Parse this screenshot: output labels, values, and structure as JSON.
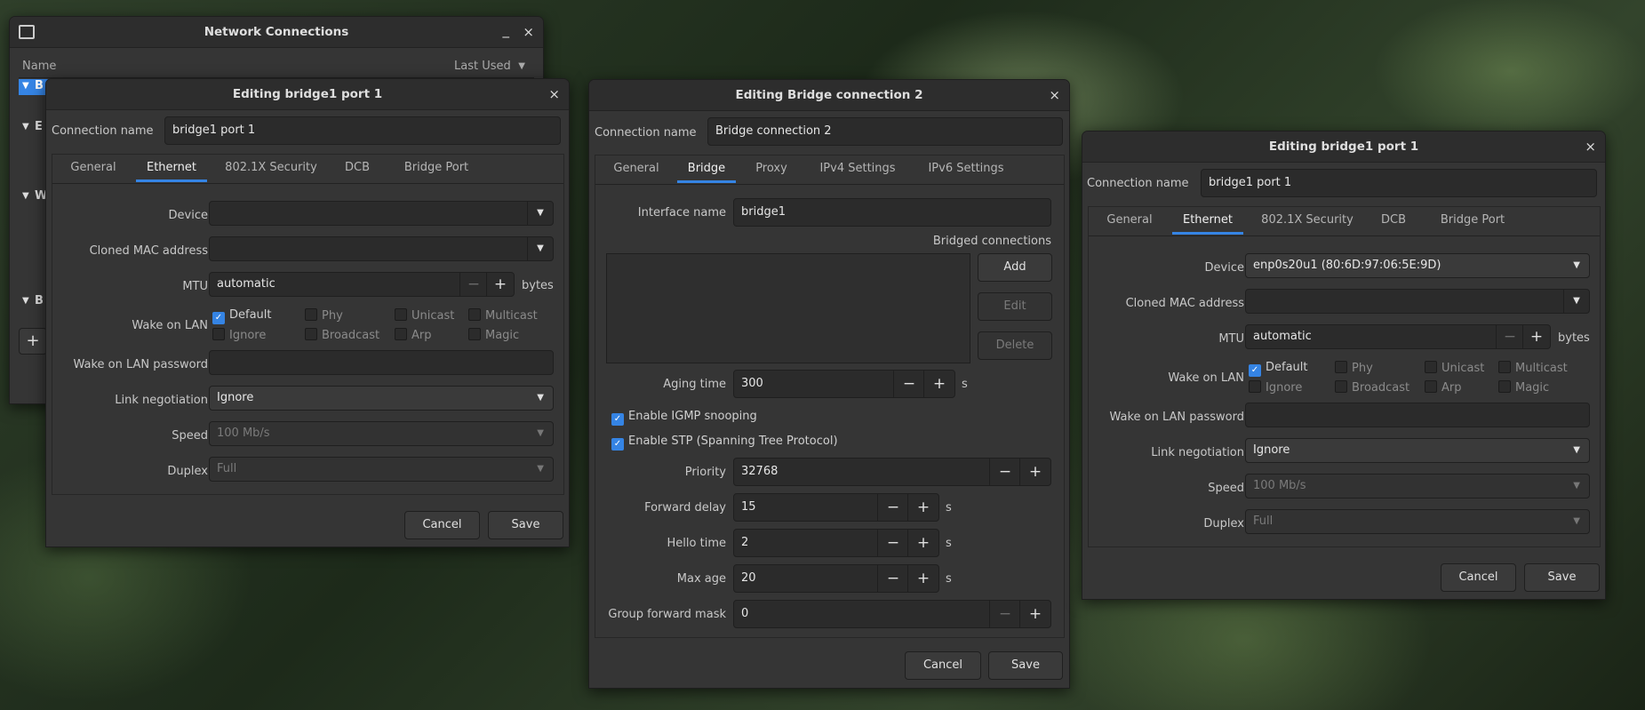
{
  "nc": {
    "title": "Network Connections",
    "col_name": "Name",
    "col_last_used": "Last Used",
    "items": [
      "B",
      "E",
      "W",
      "B"
    ],
    "add": "+"
  },
  "w1": {
    "title": "Editing bridge1 port 1",
    "conn_name_label": "Connection name",
    "conn_name_value": "bridge1 port 1",
    "tabs": [
      "General",
      "Ethernet",
      "802.1X Security",
      "DCB",
      "Bridge Port"
    ],
    "device_label": "Device",
    "device_value": "",
    "cloned_mac_label": "Cloned MAC address",
    "mtu_label": "MTU",
    "mtu_value": "automatic",
    "mtu_unit": "bytes",
    "wol_label": "Wake on LAN",
    "wol_opts": [
      "Default",
      "Phy",
      "Unicast",
      "Multicast",
      "Ignore",
      "Broadcast",
      "Arp",
      "Magic"
    ],
    "wol_pw_label": "Wake on LAN password",
    "link_neg_label": "Link negotiation",
    "link_neg_value": "Ignore",
    "speed_label": "Speed",
    "speed_value": "100 Mb/s",
    "duplex_label": "Duplex",
    "duplex_value": "Full",
    "cancel": "Cancel",
    "save": "Save"
  },
  "w2": {
    "title": "Editing Bridge connection 2",
    "conn_name_label": "Connection name",
    "conn_name_value": "Bridge connection 2",
    "tabs": [
      "General",
      "Bridge",
      "Proxy",
      "IPv4 Settings",
      "IPv6 Settings"
    ],
    "iface_label": "Interface name",
    "iface_value": "bridge1",
    "bridged_label": "Bridged connections",
    "add": "Add",
    "edit": "Edit",
    "delete": "Delete",
    "aging_label": "Aging time",
    "aging_value": "300",
    "s": "s",
    "igmp_label": "Enable IGMP snooping",
    "stp_label": "Enable STP (Spanning Tree Protocol)",
    "priority_label": "Priority",
    "priority_value": "32768",
    "fwd_label": "Forward delay",
    "fwd_value": "15",
    "hello_label": "Hello time",
    "hello_value": "2",
    "maxage_label": "Max age",
    "maxage_value": "20",
    "gfm_label": "Group forward mask",
    "gfm_value": "0",
    "cancel": "Cancel",
    "save": "Save"
  },
  "w3": {
    "title": "Editing bridge1 port 1",
    "conn_name_label": "Connection name",
    "conn_name_value": "bridge1 port 1",
    "tabs": [
      "General",
      "Ethernet",
      "802.1X Security",
      "DCB",
      "Bridge Port"
    ],
    "device_label": "Device",
    "device_value": "enp0s20u1 (80:6D:97:06:5E:9D)",
    "cloned_mac_label": "Cloned MAC address",
    "mtu_label": "MTU",
    "mtu_value": "automatic",
    "mtu_unit": "bytes",
    "wol_label": "Wake on LAN",
    "wol_opts": [
      "Default",
      "Phy",
      "Unicast",
      "Multicast",
      "Ignore",
      "Broadcast",
      "Arp",
      "Magic"
    ],
    "wol_pw_label": "Wake on LAN password",
    "link_neg_label": "Link negotiation",
    "link_neg_value": "Ignore",
    "speed_label": "Speed",
    "speed_value": "100 Mb/s",
    "duplex_label": "Duplex",
    "duplex_value": "Full",
    "cancel": "Cancel",
    "save": "Save"
  },
  "icons": {
    "check": "✓",
    "close": "×",
    "minimize": "_",
    "down": "▼",
    "minus": "−",
    "plus": "+"
  },
  "colors": {
    "accent": "#3584e4",
    "window_bg": "#353535",
    "titlebar_bg": "#2d2d2d"
  }
}
